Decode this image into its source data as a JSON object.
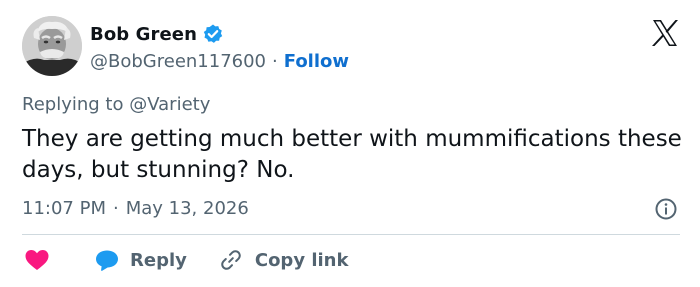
{
  "author": {
    "display_name": "Bob Green",
    "handle": "@BobGreen117600",
    "separator": "·",
    "follow_label": "Follow",
    "avatar_icon": "avatar-portrait",
    "verified_icon": "verified-badge-icon"
  },
  "tweet": {
    "reply_prefix": "Replying to",
    "reply_target": "@Variety",
    "text": "They are getting much better with mummifications these days, but stunning? No.",
    "time": "11:07 PM",
    "date_separator": "·",
    "date": "May 13, 2026"
  },
  "actions": {
    "like_icon": "heart-icon",
    "reply_label": "Reply",
    "reply_icon": "chat-bubble-icon",
    "copy_label": "Copy link",
    "copy_icon": "link-icon"
  },
  "colors": {
    "accent": "#0f6fcf",
    "verified": "#1d9bf0",
    "like": "#f91880",
    "secondary_text": "#536471",
    "primary_text": "#0f1419",
    "divider": "#cfd9de"
  }
}
